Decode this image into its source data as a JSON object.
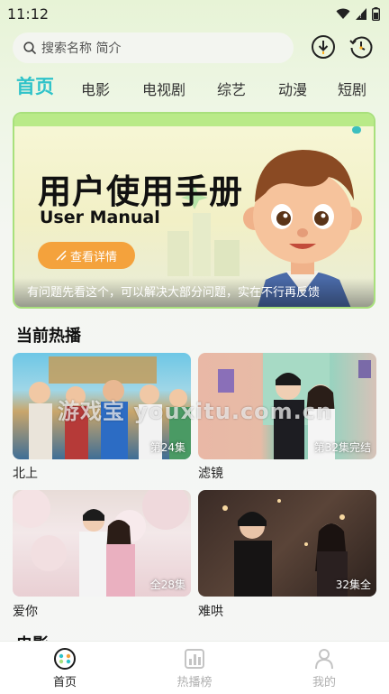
{
  "status_bar": {
    "time": "11:12"
  },
  "search": {
    "placeholder": "搜索名称 简介"
  },
  "tabs": [
    {
      "label": "首页",
      "active": true
    },
    {
      "label": "电影"
    },
    {
      "label": "电视剧"
    },
    {
      "label": "综艺"
    },
    {
      "label": "动漫"
    },
    {
      "label": "短剧"
    }
  ],
  "banner": {
    "title": "用户使用手册",
    "subtitle": "User Manual",
    "button_label": "查看详情",
    "caption": "有问题先看这个，可以解决大部分问题，实在不行再反馈"
  },
  "section": {
    "title": "当前热播"
  },
  "cards": [
    {
      "title": "北上",
      "badge": "第24集"
    },
    {
      "title": "滤镜",
      "badge": "第32集完结"
    },
    {
      "title": "爱你",
      "badge": "全28集"
    },
    {
      "title": "难哄",
      "badge": "32集全"
    }
  ],
  "next_section": {
    "title": "电影"
  },
  "watermark": "游戏宝 youxitu.com.cn",
  "bottom_nav": [
    {
      "label": "首页",
      "icon": "home-icon",
      "active": true
    },
    {
      "label": "热播榜",
      "icon": "ranking-icon"
    },
    {
      "label": "我的",
      "icon": "profile-icon"
    }
  ],
  "colors": {
    "accent": "#2fc3c9",
    "banner_button": "#f4a23c"
  }
}
